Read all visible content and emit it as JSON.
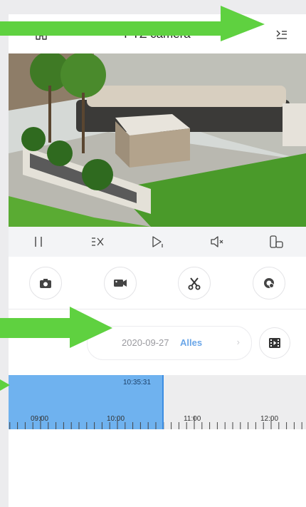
{
  "header": {
    "title": "PTZ camera",
    "home_icon": "home-icon",
    "menu_icon": "list-indent-icon"
  },
  "controls": [
    {
      "name": "pause-icon"
    },
    {
      "name": "speed-x-icon"
    },
    {
      "name": "play-step-icon"
    },
    {
      "name": "mute-icon"
    },
    {
      "name": "phone-rotate-icon"
    }
  ],
  "actions": [
    {
      "name": "snapshot-camera-icon"
    },
    {
      "name": "record-video-icon"
    },
    {
      "name": "scissors-icon"
    },
    {
      "name": "cloud-sync-icon"
    }
  ],
  "date_selector": {
    "date": "2020-09-27",
    "filter": "Alles"
  },
  "timeline": {
    "current_time": "10:35:31",
    "labels": [
      "09:00",
      "10:00",
      "11:00",
      "12:00"
    ]
  },
  "colors": {
    "accent": "#6fb2ef",
    "arrow": "#5fd140",
    "link": "#6aa6e8"
  }
}
